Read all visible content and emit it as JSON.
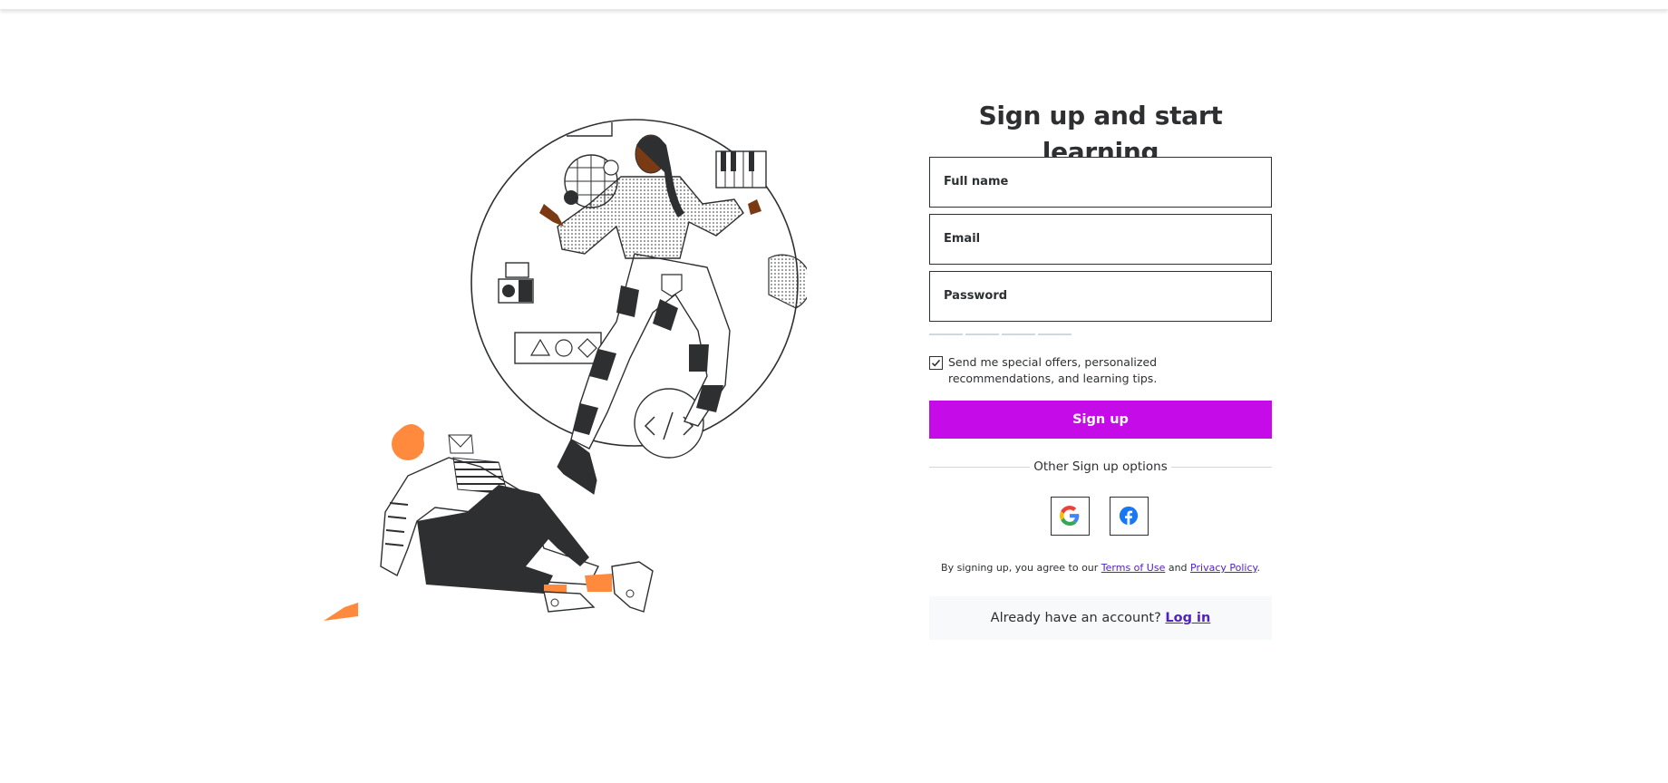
{
  "page": {
    "title": "Sign up and start learning"
  },
  "form": {
    "full_name_label": "Full name",
    "email_label": "Email",
    "password_label": "Password",
    "offers_checked": true,
    "offers_text": "Send me special offers, personalized recommendations, and learning tips.",
    "signup_label": "Sign up",
    "other_options": "Other Sign up options"
  },
  "social": [
    {
      "name": "google",
      "icon": "google-icon"
    },
    {
      "name": "facebook",
      "icon": "facebook-icon"
    }
  ],
  "legal": {
    "prefix": "By signing up, you agree to our",
    "terms": "Terms of Use",
    "and": "and",
    "privacy": "Privacy Policy",
    "suffix": "."
  },
  "login": {
    "prompt": "Already have an account?",
    "link": "Log in"
  },
  "colors": {
    "accent": "#c50ce8",
    "link": "#5022c3",
    "text": "#2d2f31",
    "login_bg": "#f7f9fa",
    "illustration_orange": "#ff8a3d"
  }
}
